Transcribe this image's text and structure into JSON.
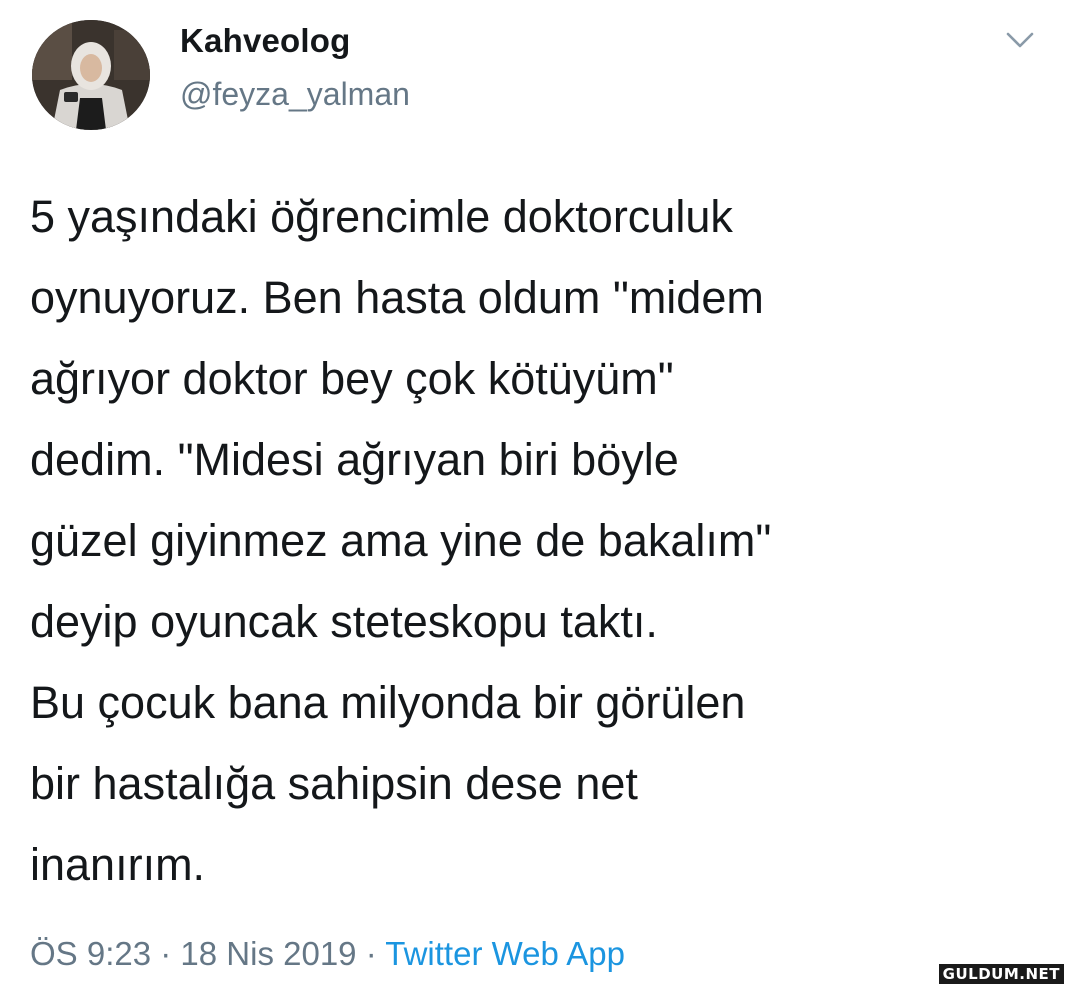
{
  "tweet": {
    "display_name": "Kahveolog",
    "handle": "@feyza_yalman",
    "text": "5 yaşındaki öğrencimle doktorculuk\noynuyoruz. Ben hasta oldum \"midem\nağrıyor doktor bey çok kötüyüm\"\ndedim. \"Midesi ağrıyan biri böyle\ngüzel giyinmez ama yine de bakalım\"\ndeyip oyuncak steteskopu taktı.\nBu çocuk bana milyonda bir görülen\nbir hastalığa sahipsin dese net\ninanırım.",
    "time": "ÖS 9:23",
    "separator": " · ",
    "date": "18 Nis 2019",
    "source": "Twitter Web App",
    "menu_icon": "chevron-down-icon"
  },
  "watermark": {
    "text": "GULDUM.NET"
  },
  "colors": {
    "text": "#14171a",
    "secondary": "#657786",
    "link": "#1b95e0",
    "background": "#ffffff"
  }
}
